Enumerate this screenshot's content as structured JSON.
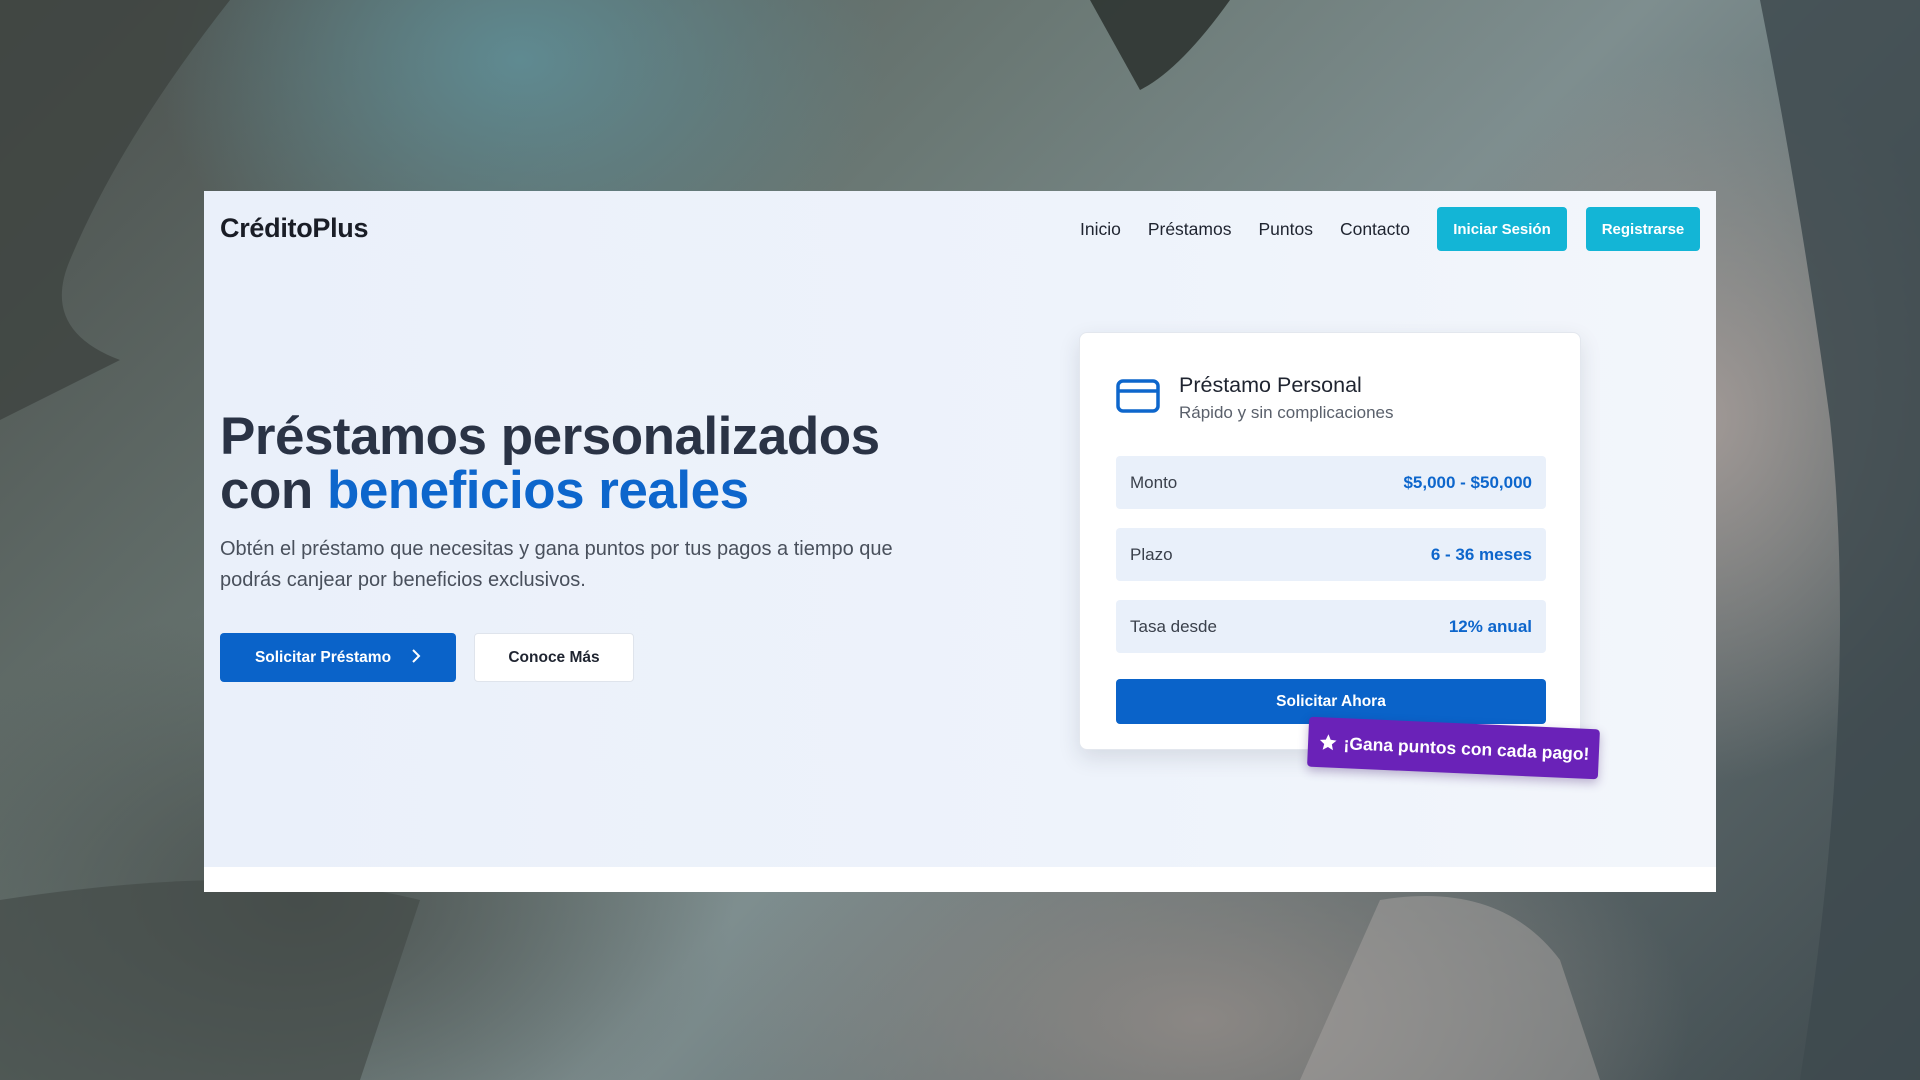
{
  "brand": {
    "logo": "CréditoPlus"
  },
  "nav": {
    "links": [
      "Inicio",
      "Préstamos",
      "Puntos",
      "Contacto"
    ],
    "login": "Iniciar Sesión",
    "register": "Registrarse"
  },
  "hero": {
    "title_line1": "Préstamos personalizados",
    "title_line2_plain": "con ",
    "title_line2_accent": "beneficios reales",
    "subtitle": "Obtén el préstamo que necesitas y gana puntos por tus pagos a tiempo que podrás canjear por beneficios exclusivos.",
    "primary_button": "Solicitar Préstamo",
    "secondary_button": "Conoce Más"
  },
  "card": {
    "icon": "credit-card-icon",
    "title": "Préstamo Personal",
    "subtitle": "Rápido y sin complicaciones",
    "rows": [
      {
        "label": "Monto",
        "value": "$5,000 - $50,000"
      },
      {
        "label": "Plazo",
        "value": "6 - 36 meses"
      },
      {
        "label": "Tasa desde",
        "value": "12% anual"
      }
    ],
    "button": "Solicitar Ahora",
    "badge": "¡Gana puntos con cada pago!"
  },
  "colors": {
    "primary": "#0a63c9",
    "accent_cyan": "#13b5d6",
    "badge_purple": "#6a22b8",
    "heading": "#2a3345"
  }
}
